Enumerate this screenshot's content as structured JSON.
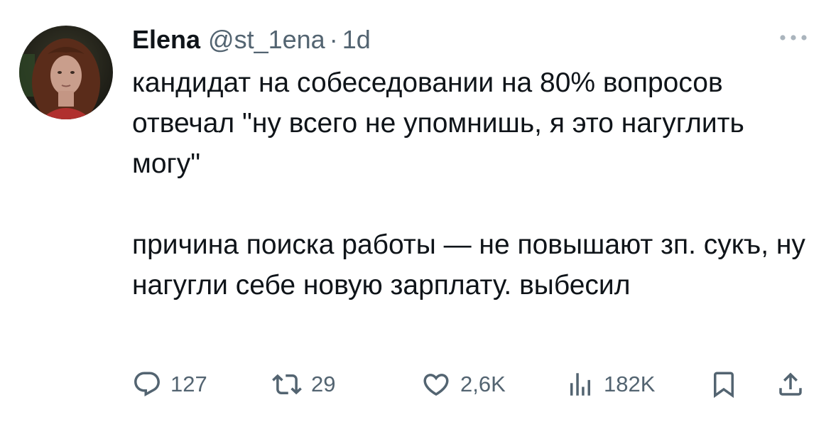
{
  "tweet": {
    "author": {
      "display_name": "Elena",
      "handle": "@st_1ena",
      "time_separator": "·",
      "time": "1d"
    },
    "body": {
      "paragraph_1": "кандидат на собеседовании на 80% вопросов отвечал \"ну всего не упомнишь, я это нагуглить могу\"",
      "paragraph_2": "причина поиска работы — не повышают зп. сукъ, ну нагугли себе новую зарплату. выбесил"
    },
    "actions": {
      "replies": "127",
      "reposts": "29",
      "likes": "2,6K",
      "views": "182K"
    },
    "icons": {
      "more": "more-horizontal-icon",
      "reply": "reply-icon",
      "repost": "repost-icon",
      "like": "heart-icon",
      "views": "views-bar-chart-icon",
      "bookmark": "bookmark-icon",
      "share": "share-icon"
    },
    "colors": {
      "text_primary": "#0f1419",
      "text_secondary": "#536471"
    }
  }
}
